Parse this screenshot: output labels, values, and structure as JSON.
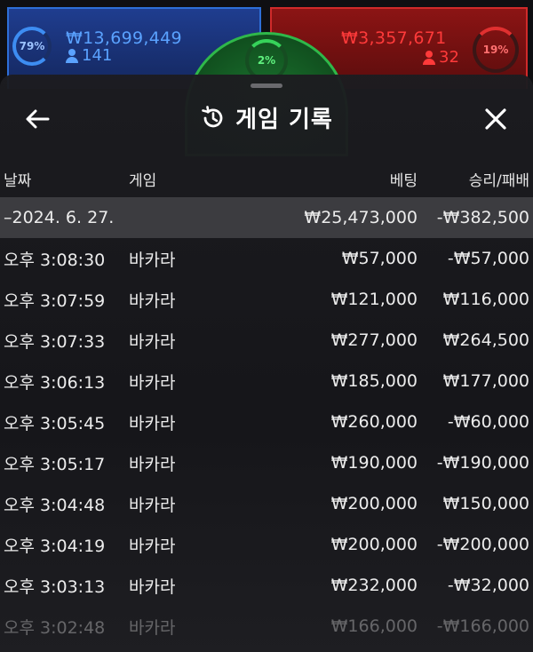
{
  "hud": {
    "blue": {
      "percent": "79%",
      "amount": "₩13,699,449",
      "players": "141"
    },
    "red": {
      "percent": "19%",
      "amount": "₩3,357,671",
      "players": "32"
    },
    "tie": {
      "percent": "2%"
    }
  },
  "sheet": {
    "title": "게임 기록",
    "columns": {
      "date": "날짜",
      "game": "게임",
      "bet": "베팅",
      "winloss": "승리/패배"
    },
    "summary": {
      "date": "–2024. 6. 27.",
      "bet": "₩25,473,000",
      "winloss": "-₩382,500"
    },
    "rows": [
      {
        "time": "오후 3:08:30",
        "game": "바카라",
        "bet": "₩57,000",
        "winloss": "-₩57,000"
      },
      {
        "time": "오후 3:07:59",
        "game": "바카라",
        "bet": "₩121,000",
        "winloss": "₩116,000"
      },
      {
        "time": "오후 3:07:33",
        "game": "바카라",
        "bet": "₩277,000",
        "winloss": "₩264,500"
      },
      {
        "time": "오후 3:06:13",
        "game": "바카라",
        "bet": "₩185,000",
        "winloss": "₩177,000"
      },
      {
        "time": "오후 3:05:45",
        "game": "바카라",
        "bet": "₩260,000",
        "winloss": "-₩60,000"
      },
      {
        "time": "오후 3:05:17",
        "game": "바카라",
        "bet": "₩190,000",
        "winloss": "-₩190,000"
      },
      {
        "time": "오후 3:04:48",
        "game": "바카라",
        "bet": "₩200,000",
        "winloss": "₩150,000"
      },
      {
        "time": "오후 3:04:19",
        "game": "바카라",
        "bet": "₩200,000",
        "winloss": "-₩200,000"
      },
      {
        "time": "오후 3:03:13",
        "game": "바카라",
        "bet": "₩232,000",
        "winloss": "-₩32,000"
      },
      {
        "time": "오후 3:02:48",
        "game": "바카라",
        "bet": "₩166,000",
        "winloss": "-₩166,000"
      }
    ]
  },
  "icons": {
    "back": "arrow-left-icon",
    "history": "history-icon",
    "close": "close-icon",
    "player": "person-icon"
  }
}
